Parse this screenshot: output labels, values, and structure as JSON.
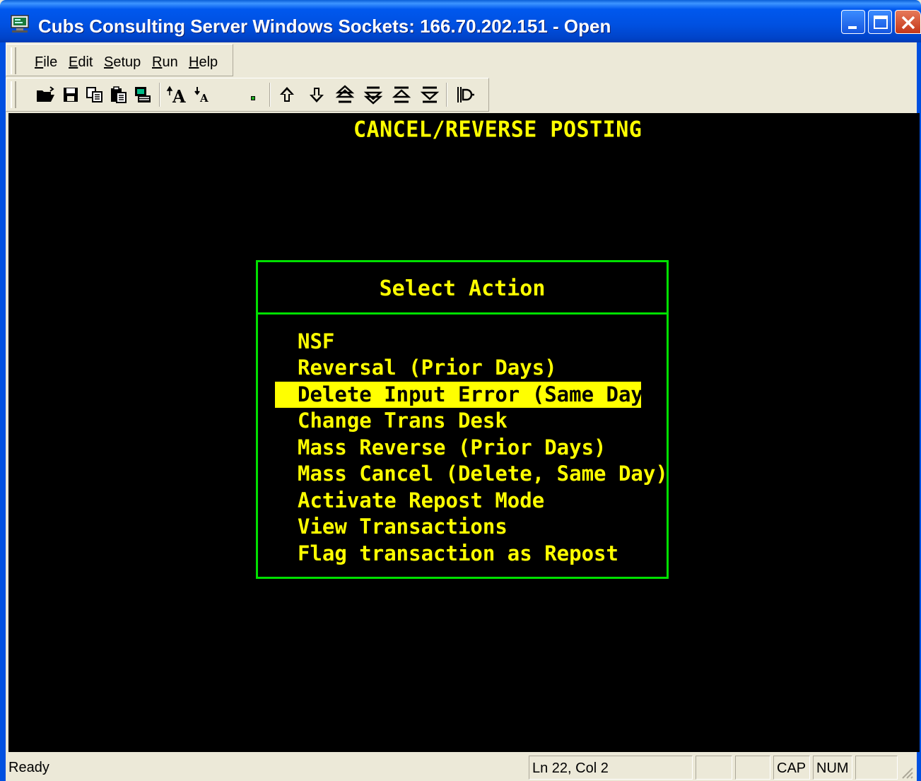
{
  "window": {
    "title": "Cubs Consulting Server Windows Sockets: 166.70.202.151 - Open",
    "app_icon": "terminal-computer-icon",
    "buttons": [
      "minimize-icon",
      "maximize-icon",
      "close-icon"
    ]
  },
  "menu": {
    "file_key": "F",
    "file_rest": "ile",
    "edit_key": "E",
    "edit_rest": "dit",
    "setup_key": "S",
    "setup_rest": "etup",
    "run_key": "R",
    "run_rest": "un",
    "help_key": "H",
    "help_rest": "elp"
  },
  "toolbar": {
    "icons": [
      "open-folder-icon",
      "save-icon",
      "copy-icon",
      "paste-icon",
      "print-screen-icon",
      "font-larger-icon",
      "font-smaller-icon",
      "small-square-icon",
      "arrow-up-icon",
      "arrow-down-icon",
      "page-up-icon",
      "page-down-icon",
      "top-icon",
      "bottom-icon",
      "connect-icon"
    ]
  },
  "terminal": {
    "screen_title": "CANCEL/REVERSE POSTING",
    "dialog_title": "Select Action",
    "options": [
      "NSF",
      "Reversal (Prior Days)",
      "Delete Input Error (Same Day)",
      "Change Trans Desk",
      "Mass Reverse (Prior Days)",
      "Mass Cancel (Delete, Same Day)",
      "Activate Repost Mode",
      "View Transactions",
      "Flag transaction as Repost"
    ],
    "selected_index": 2,
    "colors": {
      "text": "#ffff00",
      "border": "#00e000",
      "background": "#000000",
      "highlight": "#ffff00"
    }
  },
  "status": {
    "message": "Ready",
    "position": "Ln 22, Col 2",
    "cap": "CAP",
    "num": "NUM"
  }
}
